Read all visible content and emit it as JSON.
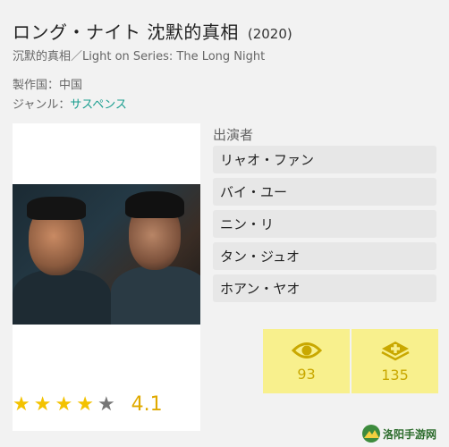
{
  "movie": {
    "title": "ロング・ナイト 沈默的真相",
    "year": "(2020)",
    "subtitle": "沉默的真相／Light on Series: The Long Night",
    "country_label": "製作国：",
    "country_value": "中国",
    "genre_label": "ジャンル：",
    "genre_value": "サスペンス"
  },
  "cast": {
    "heading": "出演者",
    "items": [
      "リャオ・ファン",
      "バイ・ユー",
      "ニン・リ",
      "タン・ジュオ",
      "ホアン・ヤオ"
    ]
  },
  "rating": {
    "stars_filled": 4,
    "stars_total": 5,
    "value": "4.1"
  },
  "stats": {
    "views": "93",
    "views_icon": "eye-icon",
    "adds": "135",
    "adds_icon": "add-to-list-icon"
  },
  "colors": {
    "star": "#f3c200",
    "genre_link": "#1a9e8f",
    "stat_bg": "#f8f08d",
    "stat_fg": "#c9a800"
  },
  "watermark": {
    "text": "洛阳手游网",
    "icon": "mountain-logo-icon"
  }
}
